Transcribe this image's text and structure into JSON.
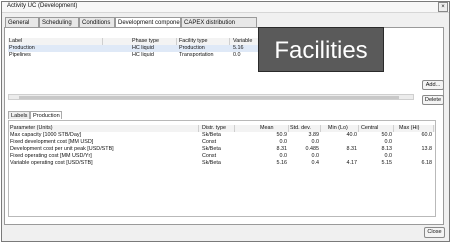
{
  "window": {
    "title": "Activity UC (Development)",
    "close_glyph": "×"
  },
  "tabs": [
    "General",
    "Scheduling",
    "Conditions",
    "Development components",
    "CAPEX distribution"
  ],
  "upper_table": {
    "headers": [
      "Label",
      "Phase type",
      "Facility type",
      "Variable"
    ],
    "rows": [
      [
        "Production",
        "HC liquid",
        "Production",
        "5.16"
      ],
      [
        "Pipelines",
        "HC liquid",
        "Transportation",
        "0.0"
      ]
    ]
  },
  "buttons": {
    "add": "Add...",
    "delete": "Delete",
    "close": "Close"
  },
  "subtabs": [
    "Labels",
    "Production"
  ],
  "lower_table": {
    "headers": [
      "Parameter (Units)",
      "Distr. type",
      "Mean",
      "Std. dev.",
      "Min (Lo)",
      "Central",
      "Max (Hi)"
    ],
    "rows": [
      [
        "Max capacity [1000 STB/Day]",
        "Sk/Beta",
        "50.9",
        "3.89",
        "40.0",
        "50.0",
        "60.0"
      ],
      [
        "Fixed development cost [MM USD]",
        "Const",
        "0.0",
        "0.0",
        "",
        "0.0",
        ""
      ],
      [
        "Development cost per unit peak [USD/STB]",
        "Sk/Beta",
        "8.31",
        "0.485",
        "8.31",
        "8.13",
        "13.8"
      ],
      [
        "Fixed operating cost [MM USD/Yr]",
        "Const",
        "0.0",
        "0.0",
        "",
        "0.0",
        ""
      ],
      [
        "Variable operating cost [USD/STB]",
        "Sk/Beta",
        "5.16",
        "0.4",
        "4.17",
        "5.15",
        "6.18"
      ]
    ]
  },
  "overlay": {
    "text": "Facilities"
  }
}
